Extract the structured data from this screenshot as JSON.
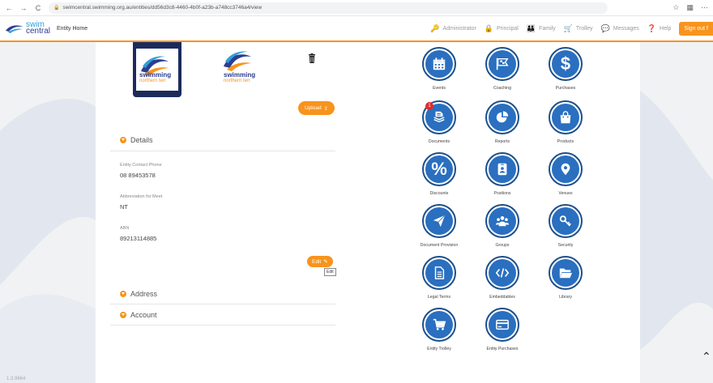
{
  "browser": {
    "back": "←",
    "forward": "→",
    "reload": "C",
    "url": "swimcentral.swimming.org.au/entities/dd56d3c8-4460-4b0f-a23b-a748cc3746a4/view"
  },
  "header": {
    "logo_line1": "swim",
    "logo_line2": "central",
    "page_name": "Entity Home",
    "items": [
      {
        "label": "Administrator",
        "icon": "key-icon"
      },
      {
        "label": "Principal",
        "icon": "lock-icon"
      },
      {
        "label": "Family",
        "icon": "family-icon"
      },
      {
        "label": "Trolley",
        "icon": "cart-icon"
      },
      {
        "label": "Messages",
        "icon": "chat-icon"
      },
      {
        "label": "Help",
        "icon": "help-icon"
      }
    ],
    "signout": "Sign out  f"
  },
  "logos": {
    "line1": "swimming",
    "line2": "northern terr"
  },
  "upload_label": "Upload",
  "details": {
    "title": "Details",
    "fields": [
      {
        "label": "Entity Contact Phone",
        "value": "08 89453578"
      },
      {
        "label": "Abbreviation for Meet",
        "value": "NT"
      },
      {
        "label": "ABN",
        "value": "89213114885"
      }
    ],
    "edit_label": "Edit",
    "edit_tooltip": "Edit"
  },
  "sections": {
    "address": "Address",
    "account": "Account"
  },
  "tiles": [
    {
      "label": "Events",
      "icon": "calendar-icon"
    },
    {
      "label": "Coaching",
      "icon": "flag-icon"
    },
    {
      "label": "Purchases",
      "icon": "dollar-icon"
    },
    {
      "label": "Documents",
      "icon": "documents-icon",
      "badge": "1"
    },
    {
      "label": "Reports",
      "icon": "pie-chart-icon"
    },
    {
      "label": "Products",
      "icon": "shopping-bag-icon"
    },
    {
      "label": "Discounts",
      "icon": "percent-icon"
    },
    {
      "label": "Positions",
      "icon": "id-badge-icon"
    },
    {
      "label": "Venues",
      "icon": "map-pin-icon"
    },
    {
      "label": "Document Provision",
      "icon": "paper-plane-icon"
    },
    {
      "label": "Groups",
      "icon": "group-icon"
    },
    {
      "label": "Security",
      "icon": "key-icon"
    },
    {
      "label": "Legal Terms",
      "icon": "file-text-icon"
    },
    {
      "label": "Embeddables",
      "icon": "code-icon"
    },
    {
      "label": "Library",
      "icon": "folder-icon"
    },
    {
      "label": "Entity Trolley",
      "icon": "cart-icon"
    },
    {
      "label": "Entity Purchases",
      "icon": "credit-card-icon"
    }
  ],
  "version": "1.3.9664",
  "colors": {
    "accent": "#f7941d",
    "tile": "#2a6fc0",
    "tile_border": "#1c4f8c"
  }
}
